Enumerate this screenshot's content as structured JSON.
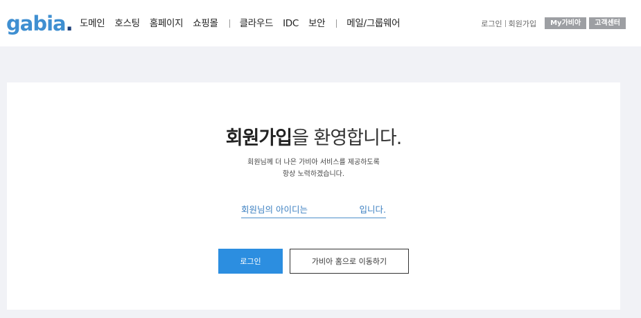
{
  "header": {
    "logo_text": "gabia",
    "logo_dot": ".",
    "nav": [
      "도메인",
      "호스팅",
      "홈페이지",
      "쇼핑몰",
      "클라우드",
      "IDC",
      "보안",
      "메일/그룹웨어"
    ],
    "util_links": [
      "로그인",
      "회원가입"
    ],
    "util_buttons": [
      "My가비아",
      "고객센터"
    ]
  },
  "main": {
    "title_strong": "회원가입",
    "title_rest": "을 환영합니다.",
    "desc_line1": "회원님께 더 나은 가비아 서비스를 제공하도록",
    "desc_line2": "항상 노력하겠습니다.",
    "id_prefix": "회원님의 아이디는",
    "id_suffix": "입니다.",
    "login_button": "로그인",
    "home_button": "가비아 홈으로 이동하기"
  },
  "colors": {
    "accent": "#2c8ee0",
    "logo": "#3f8fd1",
    "background": "#f1f2f6"
  }
}
